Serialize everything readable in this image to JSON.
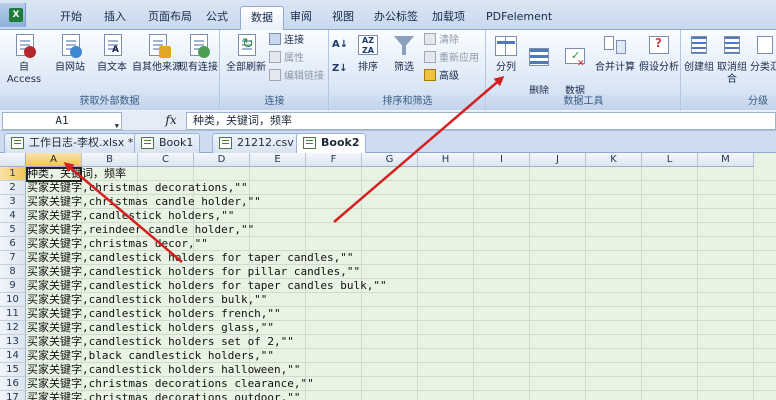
{
  "ribbon_tabs": [
    "开始",
    "插入",
    "页面布局",
    "公式",
    "数据",
    "审阅",
    "视图",
    "办公标签",
    "加载项",
    "PDFelement"
  ],
  "active_tab_index": 4,
  "groups": {
    "external": {
      "label": "获取外部数据",
      "buttons": [
        "自 Access",
        "自网站",
        "自文本",
        "自其他来源",
        "现有连接"
      ]
    },
    "connections": {
      "label": "连接",
      "refresh_all": "全部刷新",
      "small": [
        "连接",
        "属性",
        "编辑链接"
      ]
    },
    "sort_filter": {
      "label": "排序和筛选",
      "sort": "排序",
      "filter": "筛选",
      "small": [
        "清除",
        "重新应用",
        "高级"
      ]
    },
    "data_tools": {
      "label": "数据工具",
      "buttons": [
        "分列",
        "删除\n重复项",
        "数据\n有效性",
        "合并计算",
        "假设分析"
      ]
    },
    "outline": {
      "label": "分级",
      "buttons": [
        "创建组",
        "取消组合",
        "分类汇"
      ]
    }
  },
  "formula_bar": {
    "name_box": "A1",
    "fx": "fx",
    "content": "种类，关键词，频率"
  },
  "workbook_tabs": [
    {
      "label": "工作日志-李权.xlsx *",
      "active": false
    },
    {
      "label": "Book1",
      "active": false
    },
    {
      "label": "21212.csv",
      "active": false
    },
    {
      "label": "Book2",
      "active": true
    }
  ],
  "columns": [
    "A",
    "B",
    "C",
    "D",
    "E",
    "F",
    "G",
    "H",
    "I",
    "J",
    "K",
    "L",
    "M"
  ],
  "rows": [
    {
      "num": "1",
      "prefix": "种类，关键词，频率",
      "text": ""
    },
    {
      "num": "2",
      "prefix": "买家关键字",
      "text": ",christmas decorations,\"\""
    },
    {
      "num": "3",
      "prefix": "买家关键字",
      "text": ",christmas candle holder,\"\""
    },
    {
      "num": "4",
      "prefix": "买家关键字",
      "text": ",candlestick holders,\"\""
    },
    {
      "num": "5",
      "prefix": "买家关键字",
      "text": ",reindeer candle holder,\"\""
    },
    {
      "num": "6",
      "prefix": "买家关键字",
      "text": ",christmas decor,\"\""
    },
    {
      "num": "7",
      "prefix": "买家关键字",
      "text": ",candlestick holders for taper candles,\"\""
    },
    {
      "num": "8",
      "prefix": "买家关键字",
      "text": ",candlestick holders for pillar candles,\"\""
    },
    {
      "num": "9",
      "prefix": "买家关键字",
      "text": ",candlestick holders for taper candles bulk,\"\""
    },
    {
      "num": "10",
      "prefix": "买家关键字",
      "text": ",candlestick holders bulk,\"\""
    },
    {
      "num": "11",
      "prefix": "买家关键字",
      "text": ",candlestick holders french,\"\""
    },
    {
      "num": "12",
      "prefix": "买家关键字",
      "text": ",candlestick holders glass,\"\""
    },
    {
      "num": "13",
      "prefix": "买家关键字",
      "text": ",candlestick holders set of 2,\"\""
    },
    {
      "num": "14",
      "prefix": "买家关键字",
      "text": ",black candlestick holders,\"\""
    },
    {
      "num": "15",
      "prefix": "买家关键字",
      "text": ",candlestick holders halloween,\"\""
    },
    {
      "num": "16",
      "prefix": "买家关键字",
      "text": ",christmas decorations clearance,\"\""
    },
    {
      "num": "17",
      "prefix": "买家关键字",
      "text": ",christmas decorations outdoor,\"\""
    }
  ],
  "colors": {
    "arrow": "#d42020",
    "grid_bg": "#e9f3e3",
    "accent": "#2b579a"
  }
}
